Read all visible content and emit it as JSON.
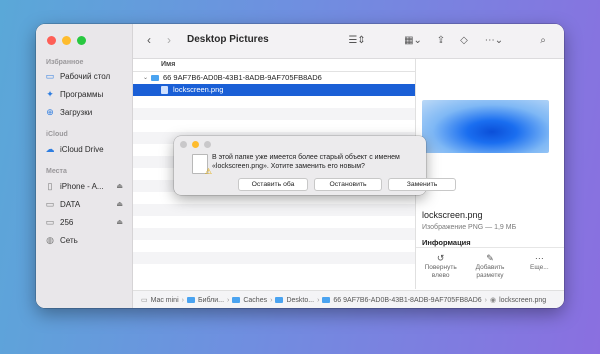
{
  "sidebar": {
    "favorites_title": "Избранное",
    "favorites": [
      {
        "label": "Рабочий стол",
        "icon": "desktop-icon"
      },
      {
        "label": "Программы",
        "icon": "apps-icon"
      },
      {
        "label": "Загрузки",
        "icon": "downloads-icon"
      }
    ],
    "icloud_title": "iCloud",
    "icloud": [
      {
        "label": "iCloud Drive",
        "icon": "cloud-icon"
      }
    ],
    "places_title": "Места",
    "places": [
      {
        "label": "iPhone - A...",
        "icon": "phone-icon",
        "eject": true
      },
      {
        "label": "DATA",
        "icon": "drive-icon",
        "eject": true
      },
      {
        "label": "256",
        "icon": "drive-icon",
        "eject": true
      },
      {
        "label": "Сеть",
        "icon": "network-icon",
        "eject": false
      }
    ]
  },
  "toolbar": {
    "title": "Desktop Pictures"
  },
  "list": {
    "column_name": "Имя",
    "folder_row": "66 9AF7B6-AD0B-43B1-8ADB-9AF705FB8AD6",
    "file_row": "lockscreen.png"
  },
  "preview": {
    "name": "lockscreen.png",
    "type": "Изображение PNG — 1,9 МБ",
    "info_title": "Информация",
    "actions": [
      {
        "label": "Повернуть влево",
        "icon": "rotate-left-icon"
      },
      {
        "label": "Добавить разметку",
        "icon": "markup-icon"
      },
      {
        "label": "Еще...",
        "icon": "more-icon"
      }
    ]
  },
  "pathbar": [
    "Mac mini",
    "Библи...",
    "Caches",
    "Deskto...",
    "66 9AF7B6-AD0B-43B1-8ADB-9AF705FB8AD6",
    "lockscreen.png"
  ],
  "dialog": {
    "message": "В этой папке уже имеется более старый объект с именем «lockscreen.png». Хотите заменить его новым?",
    "keep_both": "Оставить оба",
    "stop": "Остановить",
    "replace": "Заменить"
  },
  "colors": {
    "selection": "#1a5fd6",
    "folder": "#4aa3f0"
  }
}
